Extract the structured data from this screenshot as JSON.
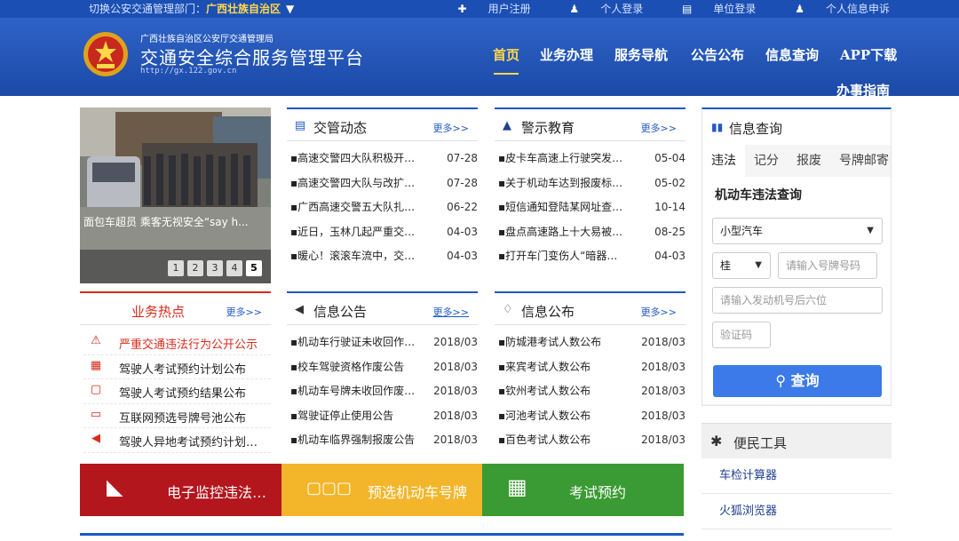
{
  "topbar": {
    "switch_label": "切换公安交通管理部门：",
    "region": "广西壮族自治区",
    "links": [
      {
        "icon": "plus-icon",
        "label": "用户注册"
      },
      {
        "icon": "user-icon",
        "label": "个人登录"
      },
      {
        "icon": "building-icon",
        "label": "单位登录"
      },
      {
        "icon": "user-icon",
        "label": "个人信息申诉"
      }
    ]
  },
  "brand": {
    "subtitle": "广西壮族自治区公安厅交通管理局",
    "title": "交通安全综合服务管理平台",
    "url": "http://gx.122.gov.cn"
  },
  "nav": {
    "items": [
      "首页",
      "业务办理",
      "服务导航",
      "公告公布",
      "信息查询",
      "APP下载",
      "办事指南"
    ],
    "active": "首页"
  },
  "slideshow": {
    "caption": "面包车超员 乘客无视安全“say h...",
    "pages": [
      "1",
      "2",
      "3",
      "4",
      "5"
    ],
    "active_page": "5"
  },
  "traffic_news": {
    "title": "交管动态",
    "more": "更多>>",
    "items": [
      {
        "title": "▪高速交警四大队积极开…",
        "date": "07-28"
      },
      {
        "title": "▪高速交警四大队与改扩…",
        "date": "07-28"
      },
      {
        "title": "▪广西高速交警五大队扎…",
        "date": "06-22"
      },
      {
        "title": "▪近日，玉林几起严重交…",
        "date": "04-03"
      },
      {
        "title": "▪暖心！滚滚车流中，交…",
        "date": "04-03"
      }
    ]
  },
  "warning_edu": {
    "title": "警示教育",
    "more": "更多>>",
    "items": [
      {
        "title": "▪皮卡车高速上行驶突发…",
        "date": "05-04"
      },
      {
        "title": "▪关于机动车达到报废标…",
        "date": "05-02"
      },
      {
        "title": "▪短信通知登陆某网址查…",
        "date": "10-14"
      },
      {
        "title": "▪盘点高速路上十大易被…",
        "date": "08-25"
      },
      {
        "title": "▪打开车门变伤人“暗器…",
        "date": "04-03"
      }
    ]
  },
  "hot": {
    "title": "业务热点",
    "more": "更多>>",
    "items": [
      {
        "icon": "warning-sign-icon",
        "label": "严重交通违法行为公开公示",
        "red": true
      },
      {
        "icon": "calendar-icon",
        "label": "驾驶人考试预约计划公布",
        "red": false
      },
      {
        "icon": "chat-icon",
        "label": "驾驶人考试预约结果公布",
        "red": false
      },
      {
        "icon": "license-plate-icon",
        "label": "互联网预选号牌号池公布",
        "red": false
      },
      {
        "icon": "megaphone-icon",
        "label": "驾驶人异地考试预约计划…",
        "red": false
      }
    ]
  },
  "info_notice": {
    "title": "信息公告",
    "more": "更多>>",
    "items": [
      {
        "title": "▪机动车行驶证未收回作…",
        "date": "2018/03"
      },
      {
        "title": "▪校车驾驶资格作废公告",
        "date": "2018/03"
      },
      {
        "title": "▪机动车号牌未收回作废…",
        "date": "2018/03"
      },
      {
        "title": "▪驾驶证停止使用公告",
        "date": "2018/03"
      },
      {
        "title": "▪机动车临界强制报废公告",
        "date": "2018/03"
      }
    ]
  },
  "info_publish": {
    "title": "信息公布",
    "more": "更多>>",
    "items": [
      {
        "title": "▪防城港考试人数公布",
        "date": "2018/03"
      },
      {
        "title": "▪来宾考试人数公布",
        "date": "2018/03"
      },
      {
        "title": "▪钦州考试人数公布",
        "date": "2018/03"
      },
      {
        "title": "▪河池考试人数公布",
        "date": "2018/03"
      },
      {
        "title": "▪百色考试人数公布",
        "date": "2018/03"
      }
    ]
  },
  "banners": [
    {
      "label": "电子监控违法…",
      "icon": "camera-icon",
      "color": "#b3161d"
    },
    {
      "label": "预选机动车号牌",
      "icon": "plate-number-icon",
      "color": "#f3b62b"
    },
    {
      "label": "考试预约",
      "icon": "calendar-icon",
      "color": "#3a9a33"
    }
  ],
  "query": {
    "title": "信息查询",
    "tabs": [
      "违法",
      "记分",
      "报废",
      "号牌邮寄"
    ],
    "active_tab": "违法",
    "heading": "机动车违法查询",
    "vehicle_type": "小型汽车",
    "province": "桂",
    "plate_placeholder": "请输入号牌号码",
    "engine_placeholder": "请输入发动机号后六位",
    "captcha_placeholder": "验证码",
    "button": "查询"
  },
  "tools": {
    "title": "便民工具",
    "items": [
      "车检计算器",
      "火狐浏览器"
    ]
  }
}
